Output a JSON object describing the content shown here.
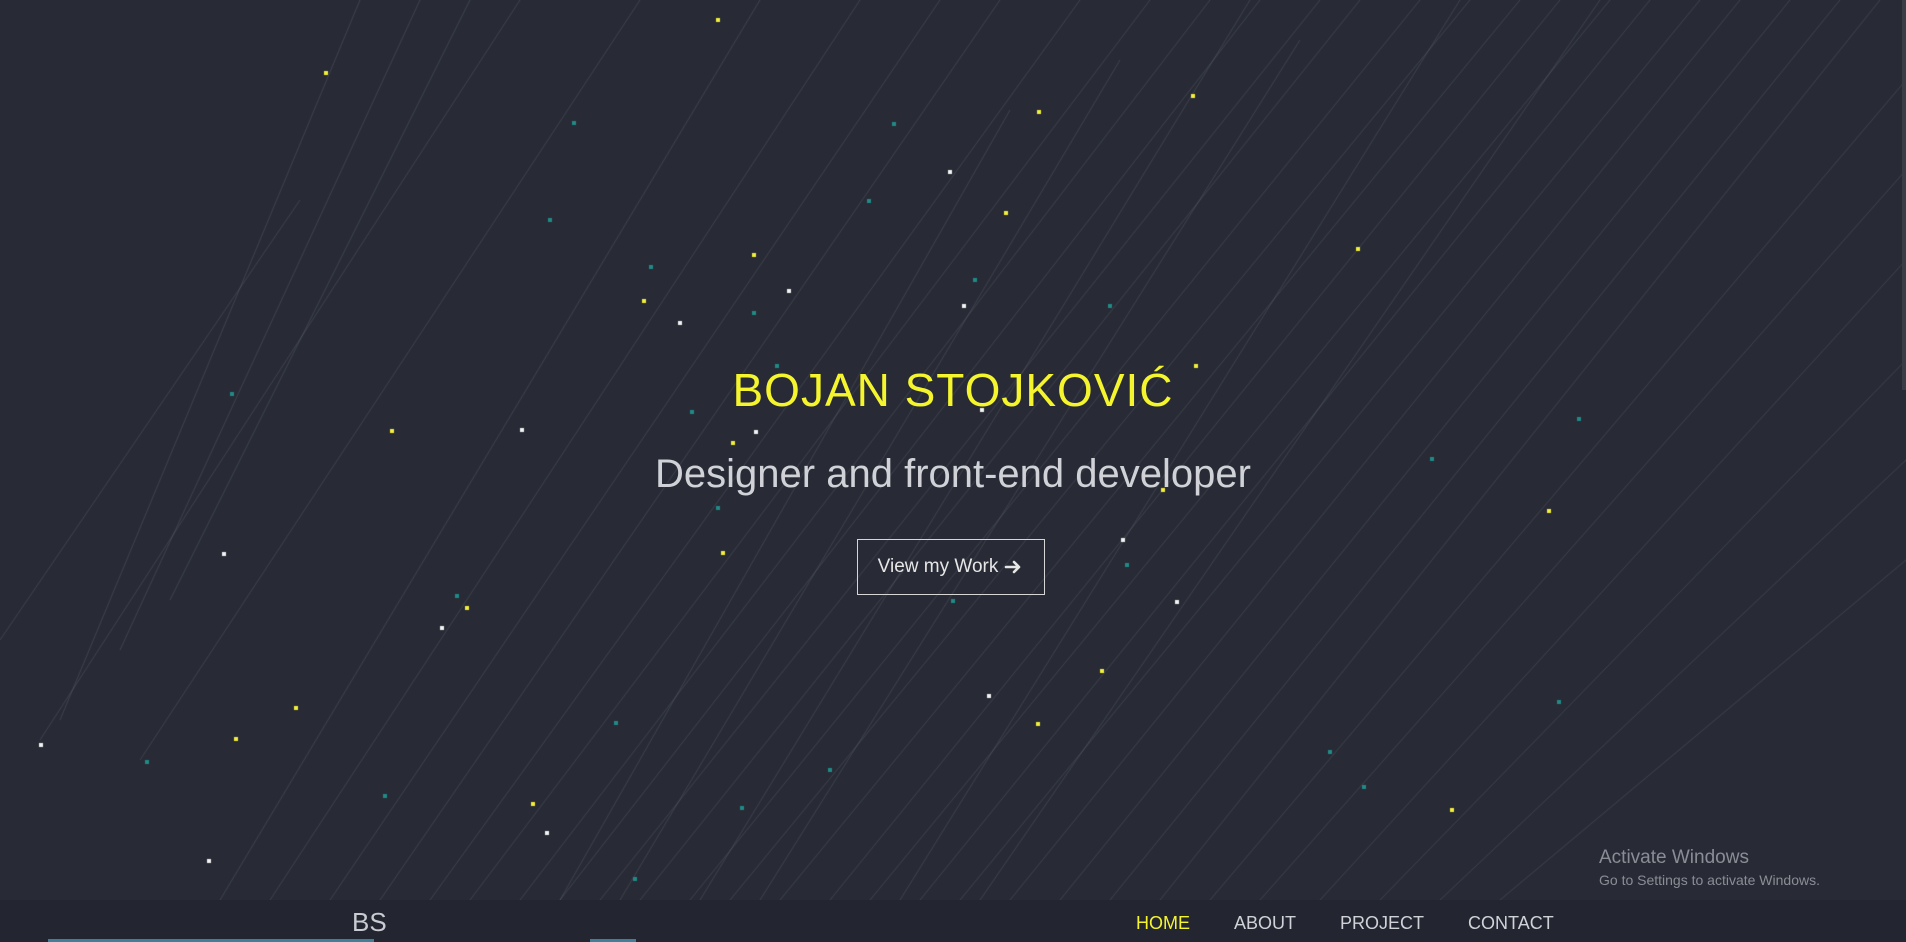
{
  "colors": {
    "background": "#282b35",
    "navbar": "#232630",
    "accent": "#f5f52e",
    "text_light": "#d0d2d8",
    "streak": "#4a4e5c",
    "dot_yellow": "#f2ee3a",
    "dot_white": "#f2f2f2",
    "dot_teal": "#1f8a86",
    "nav_underline": "#3e7f9a"
  },
  "hero": {
    "name": "BOJAN STOJKOVIĆ",
    "subtitle": "Designer and front-end developer",
    "cta_label": "View my Work",
    "cta_icon": "arrow-right-icon"
  },
  "navbar": {
    "brand": "BS",
    "items": [
      {
        "label": "HOME",
        "active": true
      },
      {
        "label": "ABOUT",
        "active": false
      },
      {
        "label": "PROJECT",
        "active": false
      },
      {
        "label": "CONTACT",
        "active": false
      }
    ]
  },
  "watermark": {
    "title": "Activate Windows",
    "subtitle": "Go to Settings to activate Windows."
  }
}
